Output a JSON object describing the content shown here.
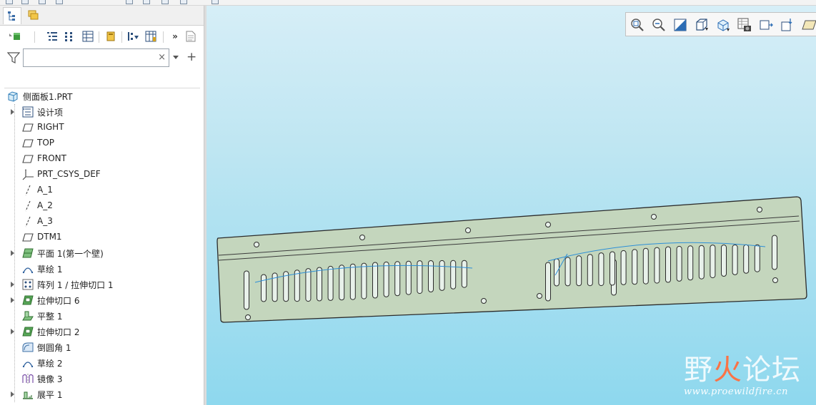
{
  "panel_tabs": [
    {
      "icon": "model-tree-icon"
    },
    {
      "icon": "layers-icon"
    }
  ],
  "tree_toolbar": {
    "icons": [
      "display-style-icon",
      "tree-columns-icon",
      "tree-filter-icon",
      "settings-icon",
      "show-icon",
      "add-column-icon",
      "more-icon",
      "notes-icon"
    ],
    "more_label": "»"
  },
  "search": {
    "value": "",
    "placeholder": "",
    "clear_label": "×",
    "add_label": "+"
  },
  "tree": {
    "root": {
      "label": "侧面板1.PRT",
      "icon": "part-icon"
    },
    "items": [
      {
        "label": "设计项",
        "icon": "design-items-icon",
        "expandable": true
      },
      {
        "label": "RIGHT",
        "icon": "datum-plane-icon",
        "expandable": false
      },
      {
        "label": "TOP",
        "icon": "datum-plane-icon",
        "expandable": false
      },
      {
        "label": "FRONT",
        "icon": "datum-plane-icon",
        "expandable": false
      },
      {
        "label": "PRT_CSYS_DEF",
        "icon": "csys-icon",
        "expandable": false
      },
      {
        "label": "A_1",
        "icon": "datum-axis-icon",
        "expandable": false
      },
      {
        "label": "A_2",
        "icon": "datum-axis-icon",
        "expandable": false
      },
      {
        "label": "A_3",
        "icon": "datum-axis-icon",
        "expandable": false
      },
      {
        "label": "DTM1",
        "icon": "datum-plane-icon",
        "expandable": false
      },
      {
        "label": "平面 1(第一个壁)",
        "icon": "planar-wall-icon",
        "expandable": true
      },
      {
        "label": "草绘 1",
        "icon": "sketch-icon",
        "expandable": false
      },
      {
        "label": "阵列 1 / 拉伸切口 1",
        "icon": "pattern-icon",
        "expandable": true
      },
      {
        "label": "拉伸切口 6",
        "icon": "extrude-cut-icon",
        "expandable": true
      },
      {
        "label": "平整 1",
        "icon": "flat-wall-icon",
        "expandable": false
      },
      {
        "label": "拉伸切口 2",
        "icon": "extrude-cut-icon",
        "expandable": true
      },
      {
        "label": "倒圆角 1",
        "icon": "round-icon",
        "expandable": false
      },
      {
        "label": "草绘 2",
        "icon": "sketch-icon",
        "expandable": false
      },
      {
        "label": "镜像 3",
        "icon": "mirror-icon",
        "expandable": false
      },
      {
        "label": "展平 1",
        "icon": "unbend-icon",
        "expandable": true
      }
    ]
  },
  "view_toolbar": {
    "icons": [
      "refit-icon",
      "zoom-in-icon",
      "zoom-out-icon",
      "repaint-icon",
      "display-style-icon",
      "saved-orientations-icon",
      "view-manager-icon",
      "perspective-icon",
      "spin-center-icon",
      "datum-display-icon"
    ]
  },
  "watermark": {
    "title_a": "野",
    "title_b": "火",
    "title_c": "论坛",
    "url": "www.proewildfire.cn"
  },
  "colors": {
    "part_face": "#c4d6bd",
    "part_edge": "#2b2b2b",
    "sketch_line": "#2c8fd8",
    "viewport_top": "#d6eef7",
    "viewport_bottom": "#8ed8ee"
  }
}
